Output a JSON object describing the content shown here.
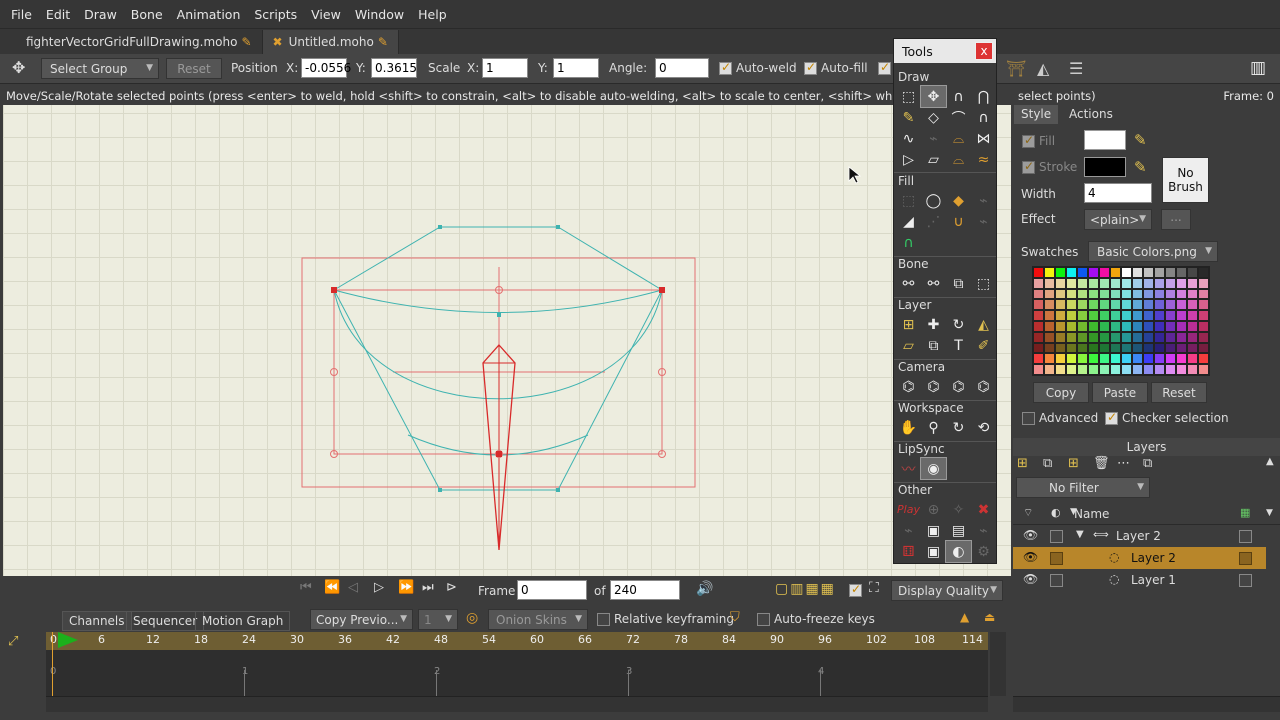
{
  "menu": [
    "File",
    "Edit",
    "Draw",
    "Bone",
    "Animation",
    "Scripts",
    "View",
    "Window",
    "Help"
  ],
  "doc_tabs": [
    {
      "label": "fighterVectorGridFullDrawing.moho",
      "active": false
    },
    {
      "label": "Untitled.moho",
      "active": true
    }
  ],
  "toolbar": {
    "select_group": "Select Group",
    "reset": "Reset",
    "position_label": "Position",
    "x_label": "X:",
    "x_value": "-0.0556",
    "y_label": "Y:",
    "y_value": "0.3615",
    "scale_label": "Scale",
    "sx_label": "X:",
    "sx_value": "1",
    "sy_label": "Y:",
    "sy_value": "1",
    "angle_label": "Angle:",
    "angle_value": "0",
    "auto_weld": "Auto-weld",
    "auto_fill": "Auto-fill"
  },
  "status": {
    "message": "Move/Scale/Rotate selected points (press <enter> to weld, hold <shift> to constrain, <alt> to disable auto-welding, <alt> to scale to center, <shift> while scaling to squa",
    "message_tail": "select points)",
    "frame": "Frame: 0"
  },
  "tools": {
    "title": "Tools",
    "close": "x",
    "sections": [
      "Draw",
      "Fill",
      "Bone",
      "Layer",
      "Camera",
      "Workspace",
      "LipSync",
      "Other"
    ]
  },
  "style_panel": {
    "tab_style": "Style",
    "tab_actions": "Actions",
    "fill": "Fill",
    "stroke": "Stroke",
    "no_brush": "No Brush",
    "width_label": "Width",
    "width_value": "4",
    "effect_label": "Effect",
    "effect_value": "<plain>",
    "more": "...",
    "swatches_label": "Swatches",
    "swatches_value": "Basic Colors.png",
    "copy": "Copy",
    "paste": "Paste",
    "reset": "Reset",
    "advanced": "Advanced",
    "checker": "Checker selection",
    "fill_color": "#ffffff",
    "stroke_color": "#000000"
  },
  "layers_panel": {
    "title": "Layers",
    "filter": "No Filter",
    "name_col": "Name",
    "rows": [
      {
        "name": "Layer 2",
        "type": "group",
        "selected": false
      },
      {
        "name": "Layer 2",
        "type": "vector",
        "selected": true
      },
      {
        "name": "Layer 1",
        "type": "vector",
        "selected": false
      }
    ]
  },
  "playback": {
    "frame_label": "Frame",
    "frame_value": "0",
    "of_label": "of",
    "total": "240",
    "display_quality": "Display Quality"
  },
  "timeline": {
    "tabs": [
      "Channels",
      "Sequencer",
      "Motion Graph"
    ],
    "copy_prev": "Copy Previo...",
    "step": "1",
    "onion": "Onion Skins",
    "relative": "Relative keyframing",
    "autofreeze": "Auto-freeze keys",
    "ruler": [
      "0",
      "6",
      "12",
      "18",
      "24",
      "30",
      "36",
      "42",
      "48",
      "54",
      "60",
      "66",
      "72",
      "78",
      "84",
      "90",
      "96",
      "102",
      "108",
      "114"
    ],
    "seconds": [
      "0",
      "1",
      "2",
      "3",
      "4"
    ]
  },
  "colors": {
    "accent": "#c28400",
    "selection": "#b8862a",
    "canvas": "#ededdf",
    "shape_cyan": "#3fb3b0",
    "shape_red": "#e24b4b"
  }
}
